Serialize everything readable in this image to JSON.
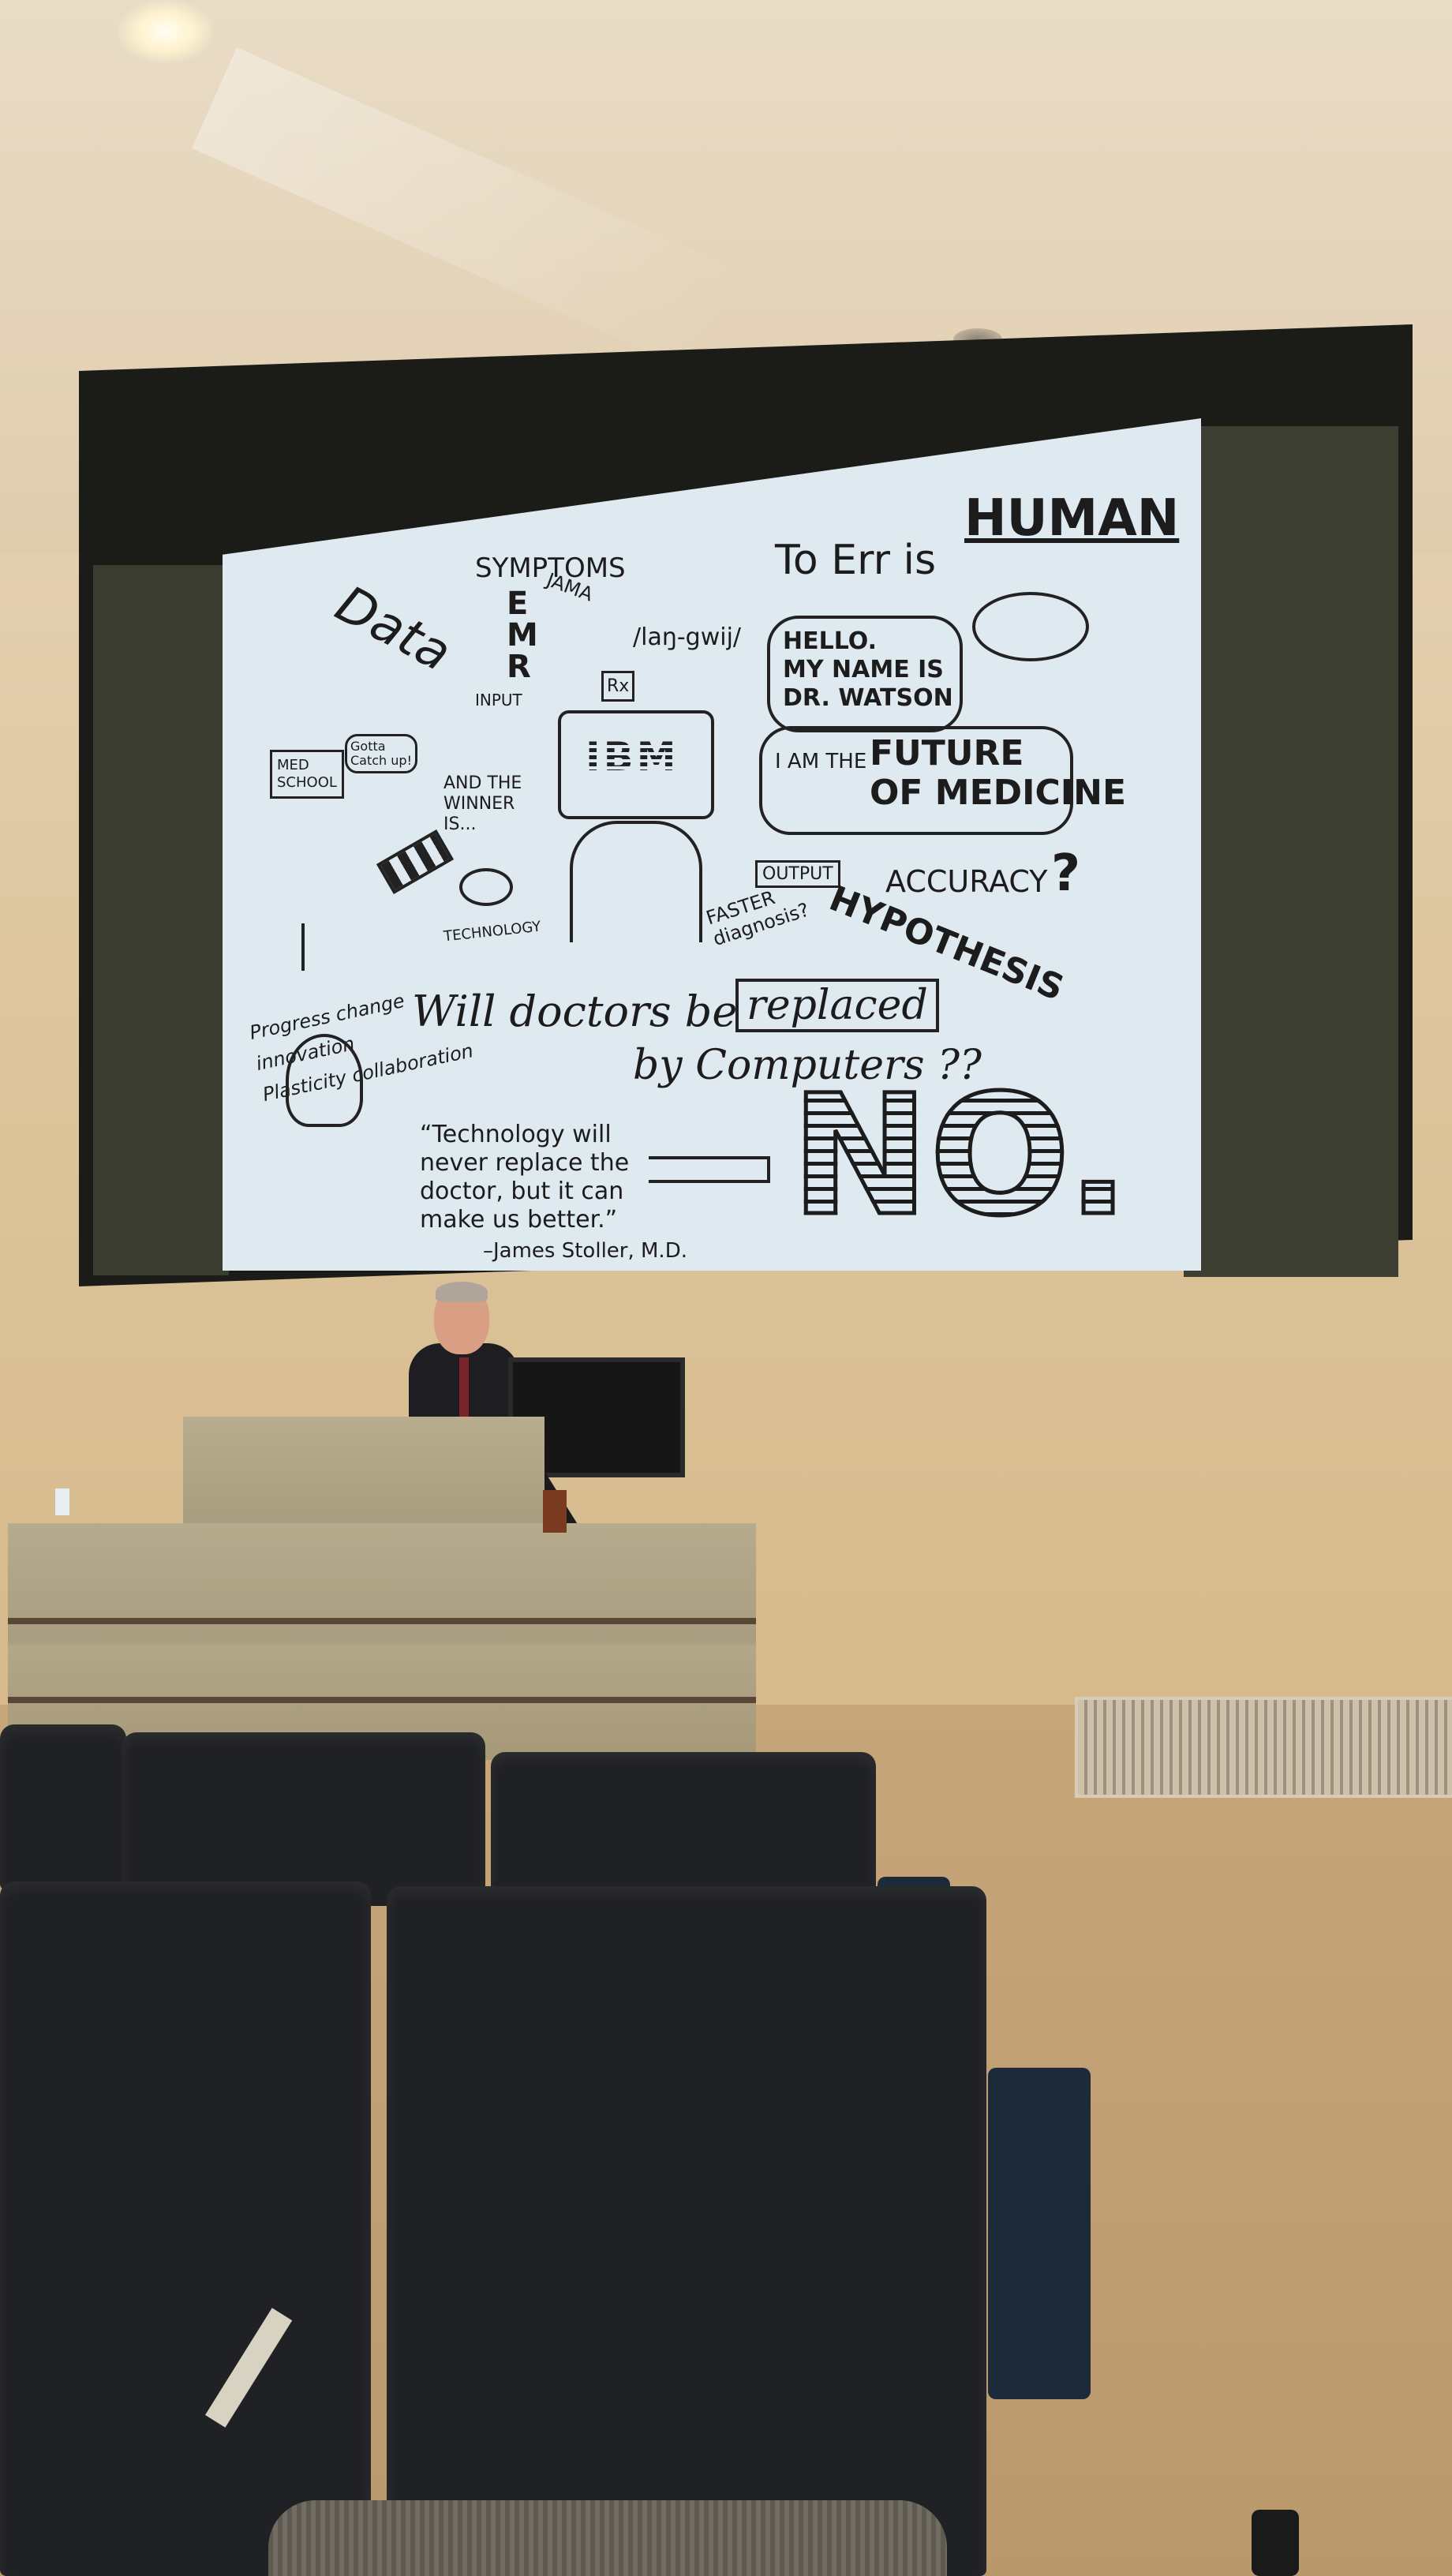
{
  "slide": {
    "title_left": "To Err is",
    "title_right": "HUMAN",
    "doodle_symptoms": "SYMPTOMS",
    "doodle_emr": "EMR",
    "doodle_data": "Data",
    "doodle_jama": "JAMA",
    "doodle_input": "INPUT",
    "doodle_language": "/laŋ-gwij/",
    "doodle_rx": "Rx",
    "doodle_med_school": "MED\nSCHOOL",
    "doodle_gotta": "Gotta\nCatch up!",
    "doodle_winner": "AND THE\nWINNER\nIS...",
    "doodle_technology": "TECHNOLOGY",
    "ibm": "IBM",
    "speech_hello": "HELLO.\nMY NAME IS\nDR. WATSON",
    "speech_future_small": "I AM THE",
    "speech_future_big": "FUTURE\nOF MEDICINE",
    "output": "OUTPUT",
    "faster": "FASTER\ndiagnosis?",
    "accuracy": "ACCURACY",
    "question_mark": "?",
    "hypothesis": "HYPOTHESIS",
    "progress_words": "Progress  change\ninnovation\nPlasticity  collaboration",
    "question_line1": "Will doctors be",
    "question_replaced": "replaced",
    "question_line2": "by Computers ??",
    "quote": "“Technology will\nnever replace the\ndoctor, but it can\nmake us better.”",
    "quote_author": "–James Stoller, M.D.",
    "answer": "NO."
  },
  "colors": {
    "slide_background": "#dfe9f0",
    "ink": "#1c1c1c",
    "wall": "#dcc39a",
    "seat": "#202124"
  }
}
